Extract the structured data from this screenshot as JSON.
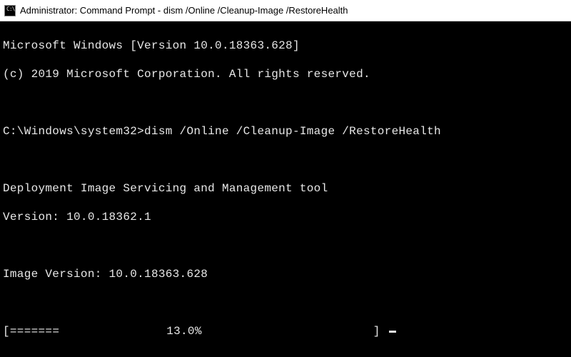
{
  "window": {
    "title": "Administrator: Command Prompt - dism  /Online /Cleanup-Image /RestoreHealth",
    "icon_label": "C:\\"
  },
  "terminal": {
    "banner_line1": "Microsoft Windows [Version 10.0.18363.628]",
    "banner_line2": "(c) 2019 Microsoft Corporation. All rights reserved.",
    "prompt_path": "C:\\Windows\\system32>",
    "command": "dism /Online /Cleanup-Image /RestoreHealth",
    "tool_name": "Deployment Image Servicing and Management tool",
    "version_label": "Version:",
    "version_value": "10.0.18362.1",
    "image_version_label": "Image Version:",
    "image_version_value": "10.0.18363.628",
    "progress": {
      "bar_open": "[",
      "bar_fill": "=======",
      "percent": "13.0%",
      "bar_close": "]"
    }
  }
}
